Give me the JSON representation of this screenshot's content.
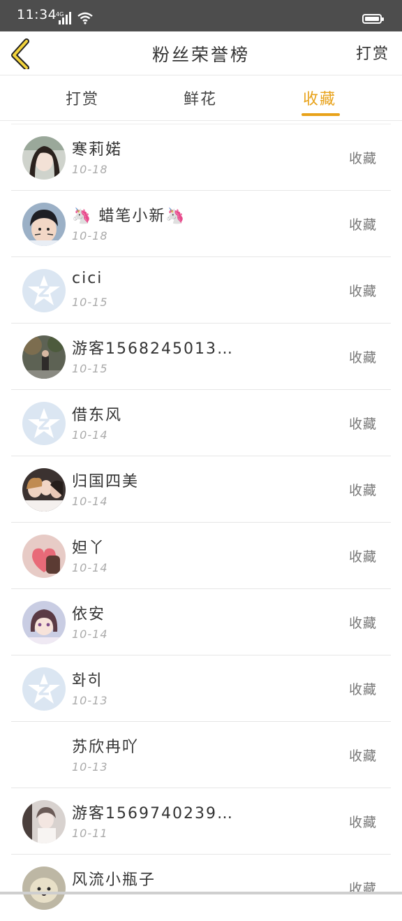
{
  "status_bar": {
    "time": "11:34",
    "network": "4G"
  },
  "header": {
    "title": "粉丝荣誉榜",
    "action": "打赏"
  },
  "tabs": [
    {
      "label": "打赏",
      "active": false
    },
    {
      "label": "鲜花",
      "active": false
    },
    {
      "label": "收藏",
      "active": true
    }
  ],
  "colors": {
    "accent": "#e8a21a",
    "statusbar": "#4d4d4d",
    "default_avatar": "#dbe6f2"
  },
  "list": [
    {
      "name": "寒莉婼",
      "date": "10-18",
      "action": "收藏",
      "avatar": "photo-girl"
    },
    {
      "name": "🦄 蜡笔小新🦄",
      "date": "10-18",
      "action": "收藏",
      "avatar": "photo-boy"
    },
    {
      "name": "cici",
      "date": "10-15",
      "action": "收藏",
      "avatar": "default-qq"
    },
    {
      "name": "游客1568245013…",
      "date": "10-15",
      "action": "收藏",
      "avatar": "photo-street"
    },
    {
      "name": "借东风",
      "date": "10-14",
      "action": "收藏",
      "avatar": "default-qq"
    },
    {
      "name": "归国四美",
      "date": "10-14",
      "action": "收藏",
      "avatar": "photo-group"
    },
    {
      "name": "妲丫",
      "date": "10-14",
      "action": "收藏",
      "avatar": "photo-heart"
    },
    {
      "name": "依安",
      "date": "10-14",
      "action": "收藏",
      "avatar": "photo-anime"
    },
    {
      "name": "화히",
      "date": "10-13",
      "action": "收藏",
      "avatar": "default-qq"
    },
    {
      "name": "苏欣冉吖",
      "date": "10-13",
      "action": "收藏",
      "avatar": "none"
    },
    {
      "name": "游客1569740239…",
      "date": "10-11",
      "action": "收藏",
      "avatar": "photo-white"
    },
    {
      "name": "风流小瓶子",
      "date": "",
      "action": "收藏",
      "avatar": "photo-dog"
    }
  ]
}
